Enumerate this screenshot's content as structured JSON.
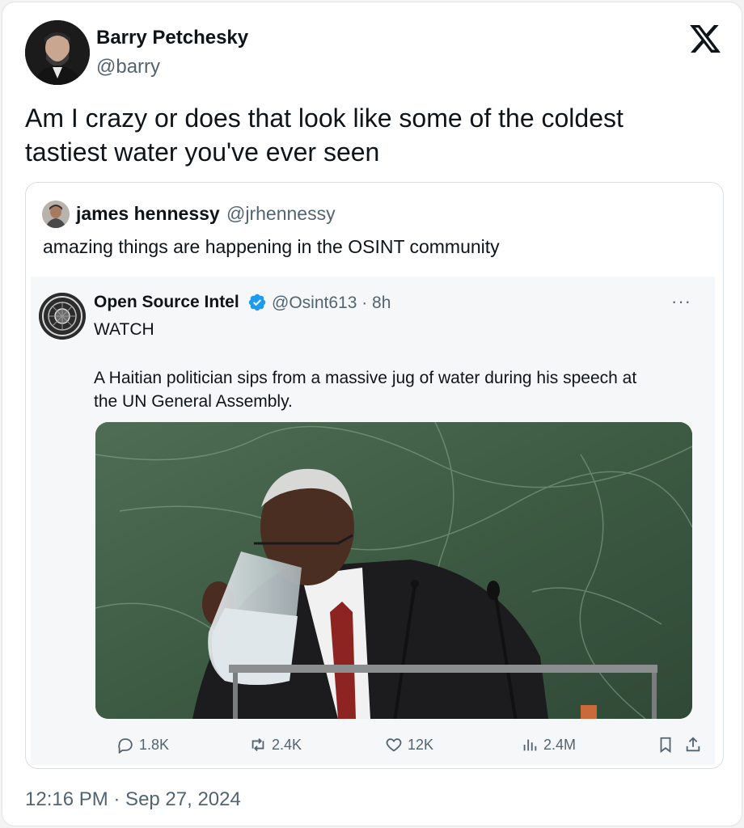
{
  "author": {
    "name": "Barry Petchesky",
    "handle": "@barry"
  },
  "tweet": {
    "text_line1": "Am I crazy or does that look like some of the coldest",
    "text_line2": "tastiest water you've ever seen",
    "timestamp": "12:16 PM · Sep 27, 2024"
  },
  "quoted": {
    "name": "james hennessy",
    "handle": "@jrhennessy",
    "text": "amazing things are happening in the OSINT community"
  },
  "inner": {
    "name": "Open Source Intel",
    "handle_time": "@Osint613 · 8h",
    "more": "···",
    "line1": "WATCH",
    "body_line1": "A Haitian politician sips from a massive jug of water during his speech at",
    "body_line2": "the UN General Assembly.",
    "stats": {
      "replies": "1.8K",
      "reposts": "2.4K",
      "likes": "12K",
      "views": "2.4M"
    }
  },
  "icons": {
    "brand": "x-logo-icon",
    "verified": "verified-badge-icon",
    "reply": "reply-icon",
    "repost": "repost-icon",
    "like": "heart-icon",
    "views": "views-icon",
    "bookmark": "bookmark-icon",
    "share": "share-icon"
  },
  "colors": {
    "text": "#0f1419",
    "muted": "#536471",
    "verified": "#1d9bf0",
    "marble": "#3f5b45"
  }
}
